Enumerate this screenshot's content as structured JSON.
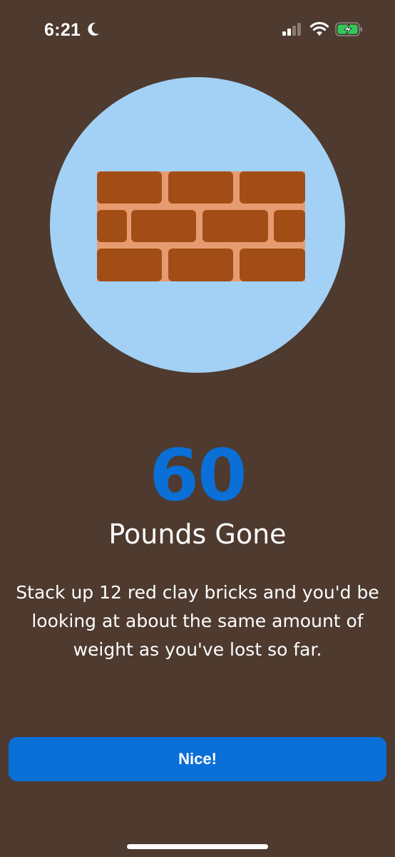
{
  "status_bar": {
    "time": "6:21",
    "icons": [
      "moon-icon",
      "cellular-signal-icon",
      "wifi-icon",
      "battery-charging-icon"
    ],
    "battery_color": "#34c759"
  },
  "illustration": {
    "icon": "brick-wall-icon",
    "circle_color": "#a3d1f5",
    "brick_color": "#a34d16",
    "mortar_color": "#e79b70"
  },
  "achievement": {
    "value": "60",
    "unit_label": "Pounds Gone",
    "description": "Stack up 12 red clay bricks and you'd be looking at about the same amount of weight as you've lost so far."
  },
  "actions": {
    "confirm_label": "Nice!"
  },
  "colors": {
    "background": "#4e3a2f",
    "accent": "#0a6fd6",
    "text": "#ffffff"
  }
}
